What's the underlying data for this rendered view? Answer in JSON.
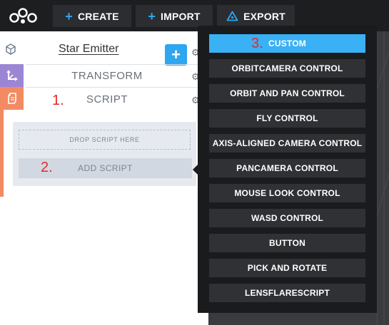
{
  "toolbar": {
    "create_label": "CREATE",
    "import_label": "IMPORT",
    "export_label": "EXPORT"
  },
  "entity": {
    "name": "Star Emitter",
    "add_component_label": "+"
  },
  "components": {
    "transform_label": "TRANSFORM",
    "script_label": "SCRIPT",
    "drop_script_label": "DROP SCRIPT HERE",
    "add_script_label": "ADD SCRIPT"
  },
  "annotations": {
    "step1": "1.",
    "step2": "2.",
    "step3": "3."
  },
  "menu": {
    "items": [
      "CUSTOM",
      "ORBITCAMERA CONTROL",
      "ORBIT AND PAN CONTROL",
      "FLY CONTROL",
      "AXIS-ALIGNED CAMERA CONTROL",
      "PANCAMERA CONTROL",
      "MOUSE LOOK CONTROL",
      "WASD CONTROL",
      "BUTTON",
      "PICK AND ROTATE",
      "LENSFLARESCRIPT"
    ],
    "selected_index": 0
  },
  "colors": {
    "accent": "#2fa6f0",
    "menu_selected": "#3ab0f5",
    "transform_tab": "#9b86d6",
    "script_tab": "#f38a62",
    "annotation": "#e32a2a"
  },
  "icons": {
    "logo": "playcanvas-logo",
    "entity": "entity-cube-icon",
    "transform": "transform-axes-icon",
    "script": "script-file-icon",
    "settings": "gear-icon",
    "export": "export-triangle-icon"
  }
}
